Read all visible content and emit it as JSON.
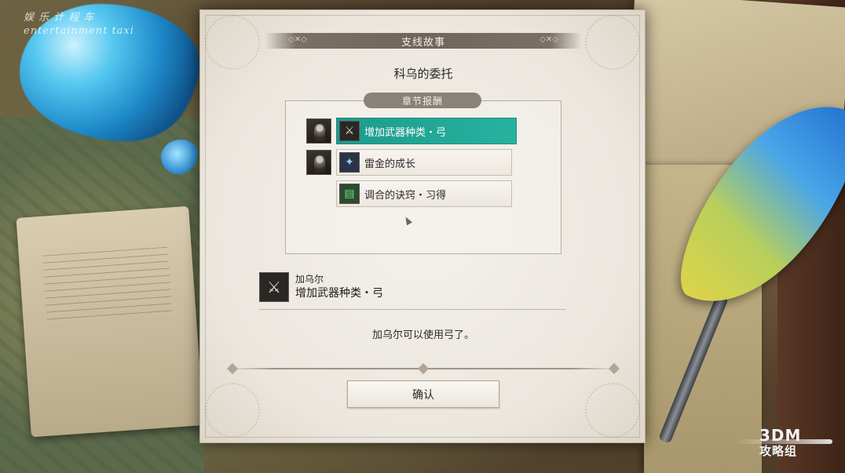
{
  "watermark": {
    "line1": "娱 乐 计 程 车",
    "line2": "entertainment taxi"
  },
  "dialog": {
    "title": "支线故事",
    "quest_name": "科乌的委托",
    "reward_header": "章节报酬",
    "rewards": [
      {
        "label": "增加武器种类・弓",
        "icon": "weapon-icon",
        "selected": true,
        "has_portrait": true
      },
      {
        "label": "雷金的成长",
        "icon": "wings-icon",
        "selected": false,
        "has_portrait": true
      },
      {
        "label": "调合的诀窍・习得",
        "icon": "scroll-icon",
        "selected": false,
        "has_portrait": false
      }
    ],
    "detail": {
      "character": "加乌尔",
      "reward": "增加武器种类・弓",
      "icon": "weapon-icon"
    },
    "description": "加乌尔可以使用弓了。",
    "confirm_label": "确认"
  },
  "logo": {
    "line1": "3DM",
    "line2": "攻略组"
  },
  "colors": {
    "selected_item": "#23a896",
    "dialog_bg": "#efebe5",
    "title_bar": "#6f655b"
  }
}
